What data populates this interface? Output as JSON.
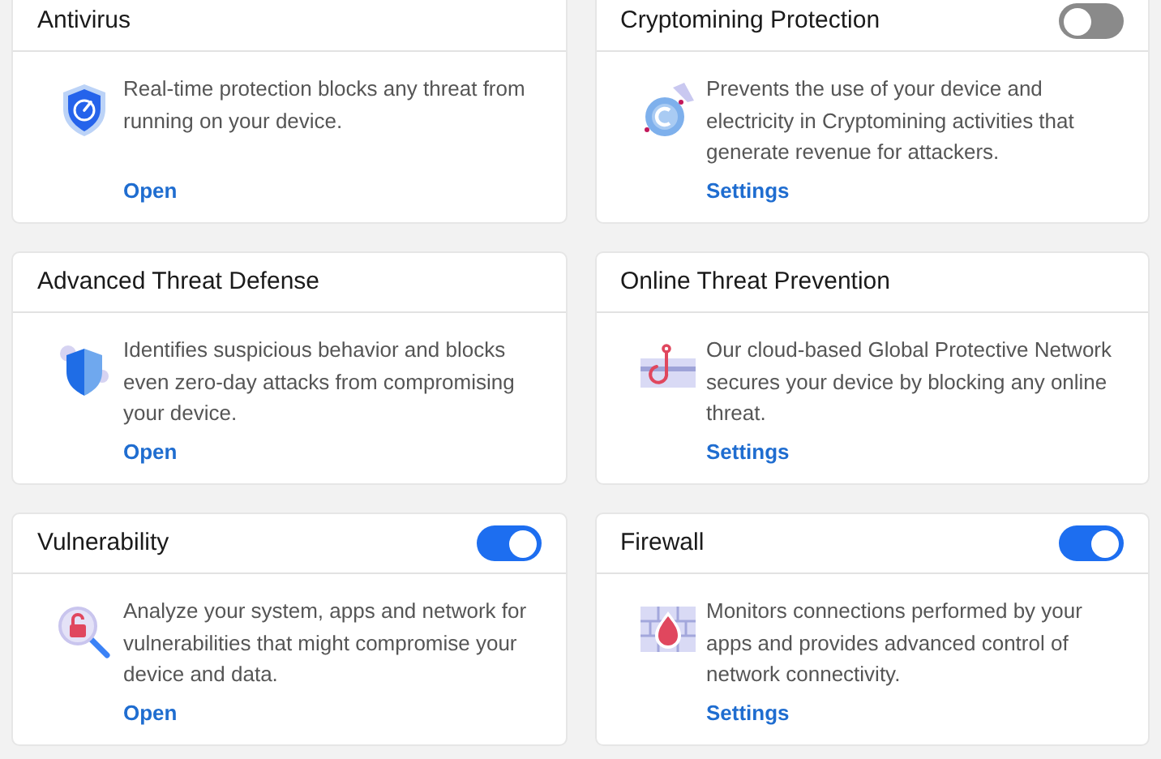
{
  "cards": [
    {
      "title": "Antivirus",
      "description": "Real-time protection blocks any threat from running on your device.",
      "link": "Open"
    },
    {
      "title": "Cryptomining Protection",
      "description": "Prevents the use of your device and electricity in Cryptomining activities that generate revenue for attackers.",
      "link": "Settings",
      "toggle": {
        "on": false
      }
    },
    {
      "title": "Advanced Threat Defense",
      "description": "Identifies suspicious behavior and blocks even zero-day attacks from compromising your device.",
      "link": "Open"
    },
    {
      "title": "Online Threat Prevention",
      "description": "Our cloud-based Global Protective Network secures your device by blocking any online threat.",
      "link": "Settings"
    },
    {
      "title": "Vulnerability",
      "description": "Analyze your system, apps and network for vulnerabilities that might compromise your device and data.",
      "link": "Open",
      "toggle": {
        "on": true
      }
    },
    {
      "title": "Firewall",
      "description": "Monitors connections performed by your apps and provides advanced control of network connectivity.",
      "link": "Settings",
      "toggle": {
        "on": true
      }
    }
  ]
}
